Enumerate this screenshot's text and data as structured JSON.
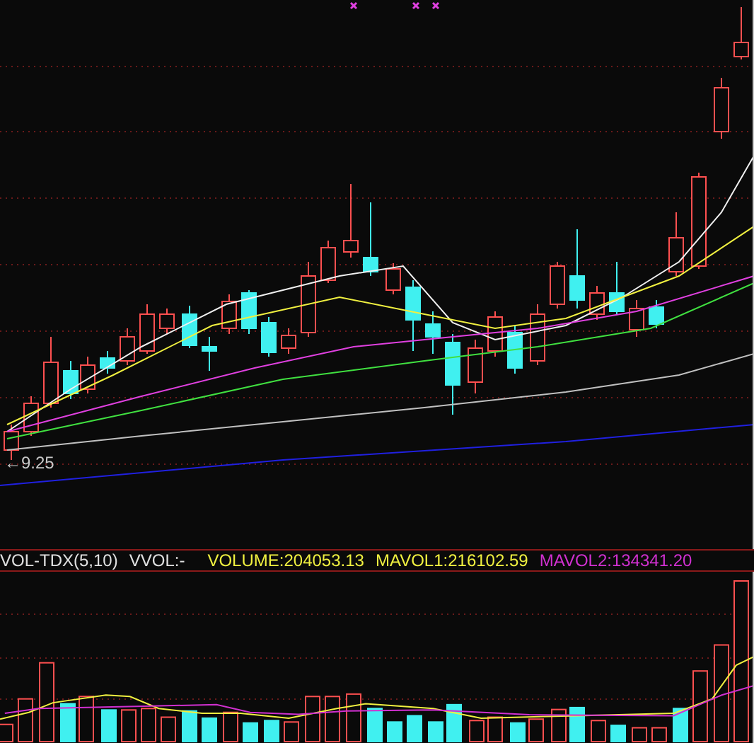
{
  "price_panel": {
    "low_marker": "←9.25"
  },
  "indicator_bar": [
    {
      "kind": "name",
      "text": "VOL-TDX(5,10)"
    },
    {
      "kind": "name",
      "text": "VVOL:-"
    },
    {
      "kind": "value",
      "text": "VOLUME:204053.13"
    },
    {
      "kind": "value",
      "text": "MAVOL1:216102.59"
    },
    {
      "kind": "secondary",
      "text": "MAVOL2:134341.20"
    }
  ]
}
